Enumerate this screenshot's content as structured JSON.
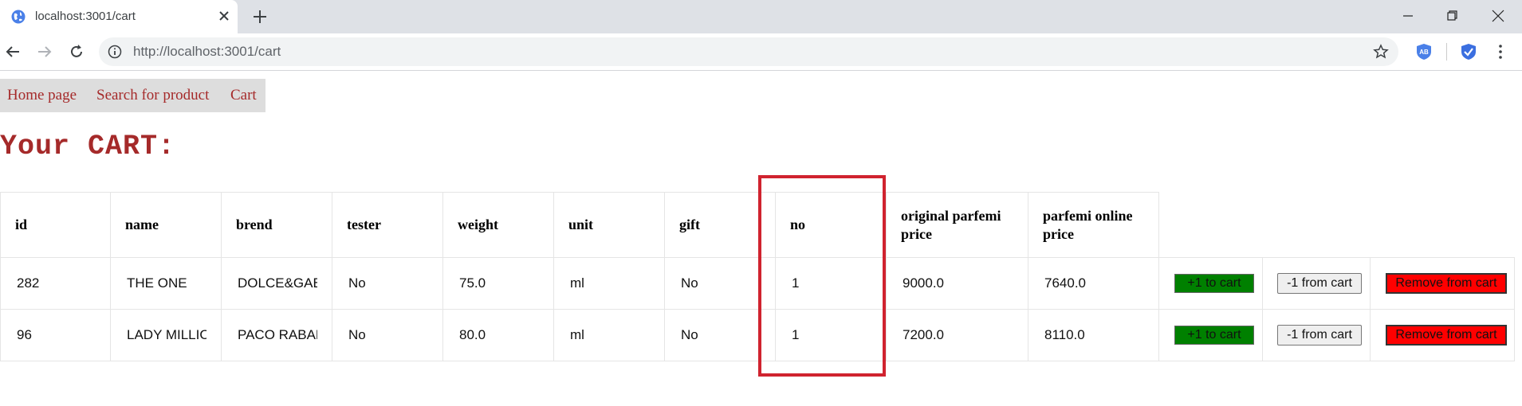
{
  "browser": {
    "tab_title": "localhost:3001/cart",
    "url": "http://localhost:3001/cart"
  },
  "nav": {
    "home": "Home page",
    "search": "Search for product",
    "cart": "Cart"
  },
  "page": {
    "heading": "Your CART:"
  },
  "table": {
    "headers": {
      "id": "id",
      "name": "name",
      "brend": "brend",
      "tester": "tester",
      "weight": "weight",
      "unit": "unit",
      "gift": "gift",
      "no": "no",
      "original_price": "original parfemi price",
      "online_price": "parfemi online price"
    },
    "rows": [
      {
        "id": "282",
        "name": "THE ONE",
        "brend": "DOLCE&GABBANA",
        "tester": "No",
        "weight": "75.0",
        "unit": "ml",
        "gift": "No",
        "no": "1",
        "original_price": "9000.0",
        "online_price": "7640.0"
      },
      {
        "id": "96",
        "name": "LADY MILLION",
        "brend": "PACO RABANNE",
        "tester": "No",
        "weight": "80.0",
        "unit": "ml",
        "gift": "No",
        "no": "1",
        "original_price": "7200.0",
        "online_price": "8110.0"
      }
    ],
    "buttons": {
      "add": "+1 to cart",
      "sub": "-1 from cart",
      "remove": "Remove from cart"
    }
  },
  "colors": {
    "accent": "#a52a2a",
    "add_button": "#008000",
    "remove_button": "#ff0000",
    "highlight": "#d0232f"
  }
}
